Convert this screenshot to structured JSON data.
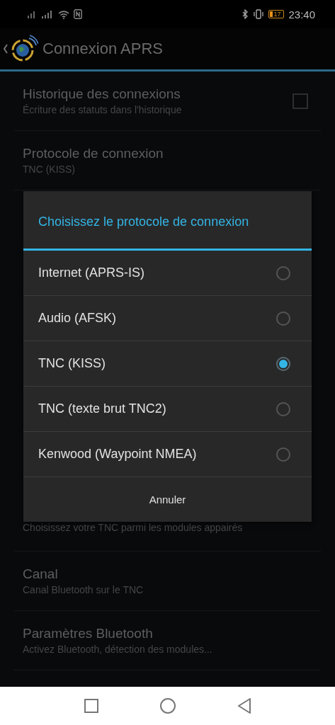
{
  "status_bar": {
    "battery": "17",
    "time": "23:40"
  },
  "action_bar": {
    "title": "Connexion APRS"
  },
  "preferences_top": [
    {
      "title": "Historique des connexions",
      "subtitle": "Écriture des statuts dans l'historique",
      "checked": false
    },
    {
      "title": "Protocole de connexion",
      "subtitle": "TNC (KISS)"
    }
  ],
  "preferences_bottom": [
    {
      "subtitle": "Choisissez votre TNC parmi les modules appairés"
    },
    {
      "title": "Canal",
      "subtitle": "Canal Bluetooth sur le TNC"
    },
    {
      "title": "Paramètres Bluetooth",
      "subtitle": "Activez Bluetooth, détection des modules..."
    }
  ],
  "dialog": {
    "title": "Choisissez le protocole de connexion",
    "options": [
      {
        "label": "Internet (APRS-IS)",
        "selected": false
      },
      {
        "label": "Audio (AFSK)",
        "selected": false
      },
      {
        "label": "TNC (KISS)",
        "selected": true
      },
      {
        "label": "TNC (texte brut TNC2)",
        "selected": false
      },
      {
        "label": "Kenwood (Waypoint NMEA)",
        "selected": false
      }
    ],
    "cancel": "Annuler"
  }
}
